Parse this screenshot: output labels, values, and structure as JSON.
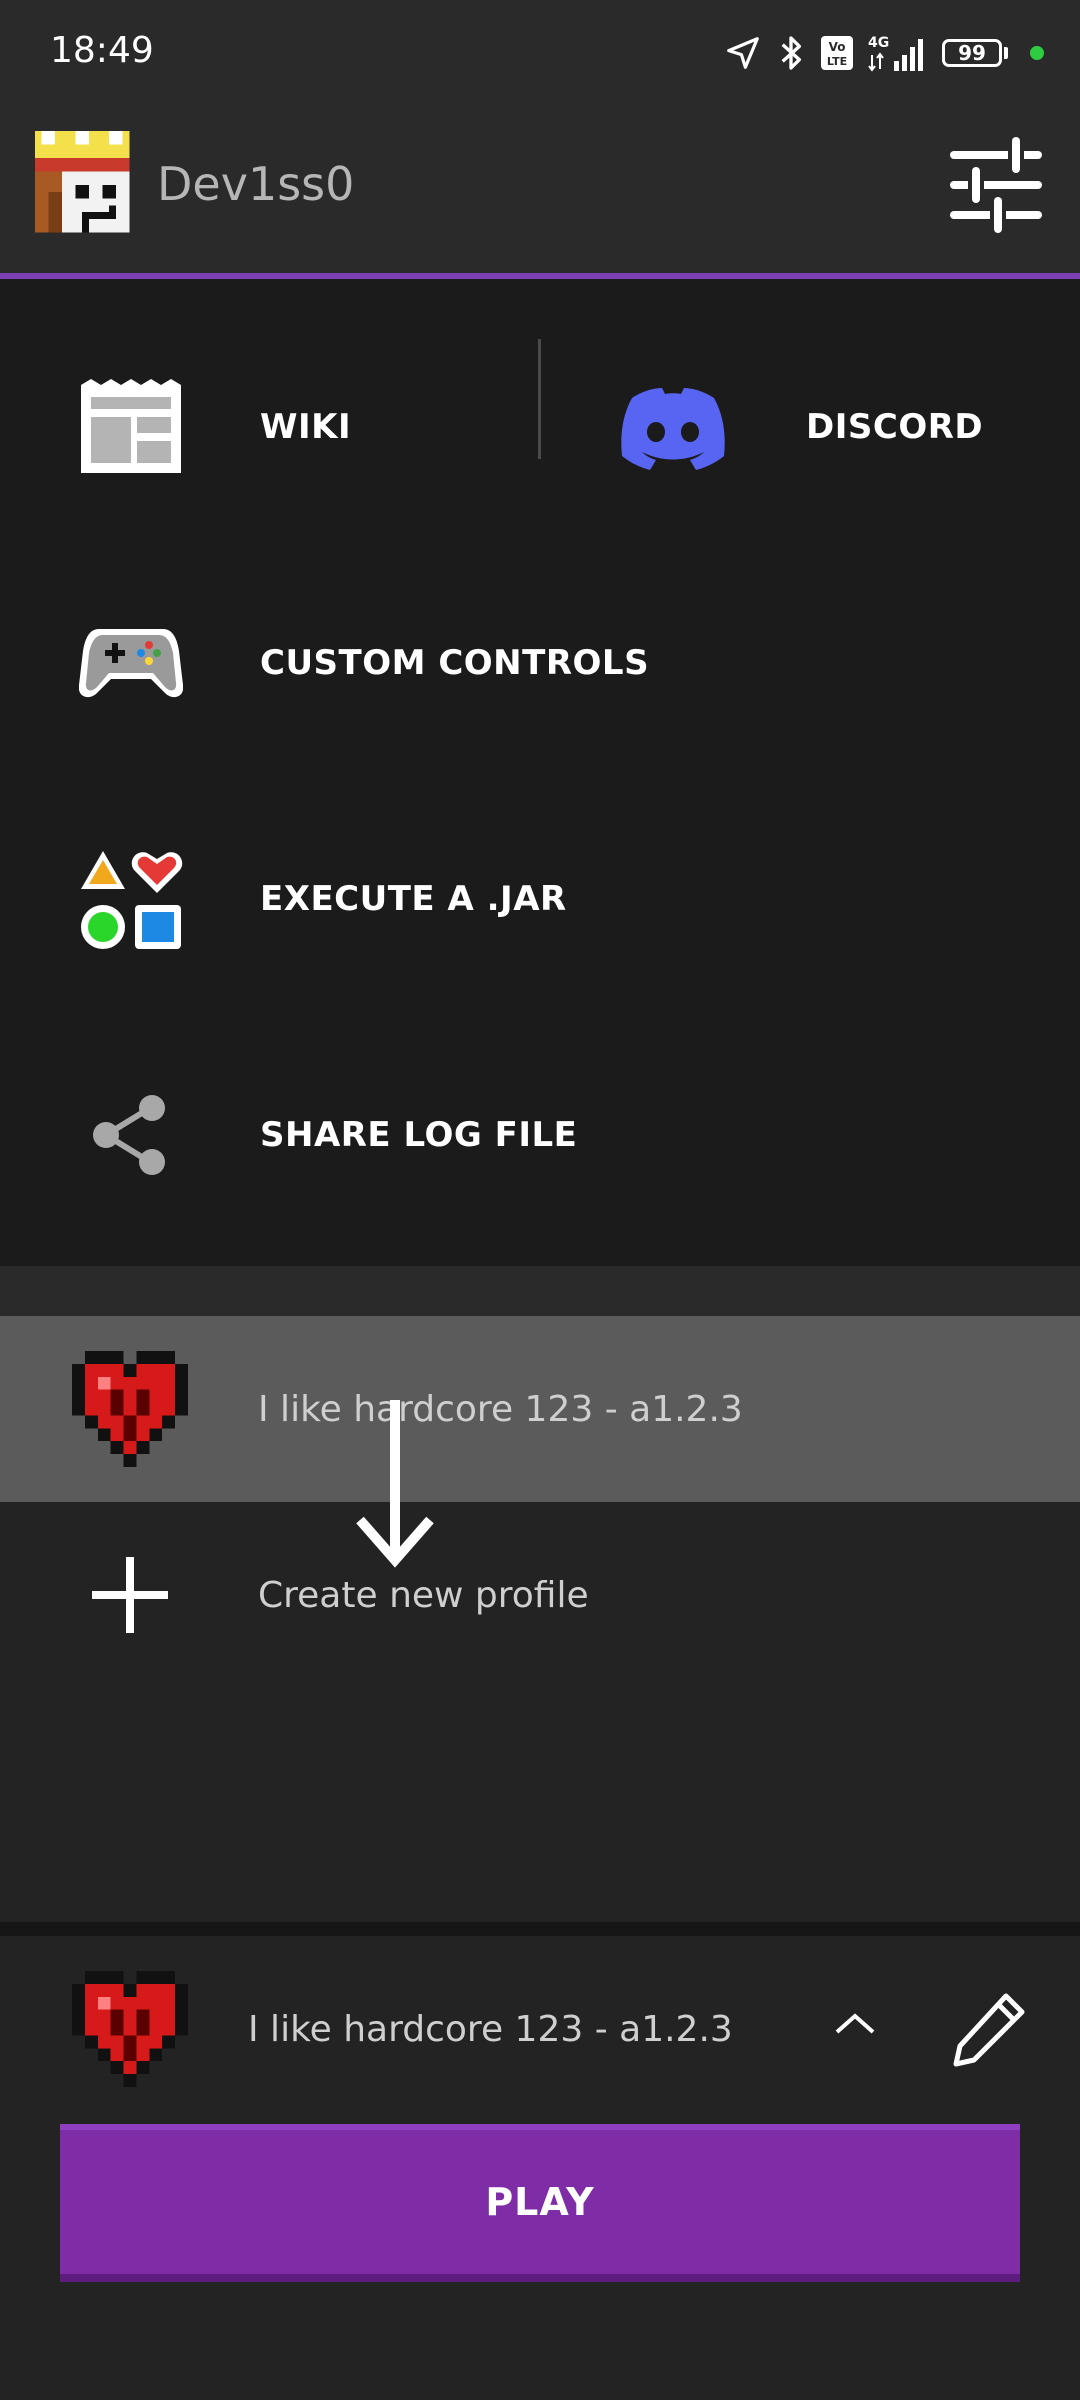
{
  "status_bar": {
    "time": "18:49",
    "battery": "99",
    "network": "4G",
    "volte": "Vo LTE"
  },
  "header": {
    "username": "Dev1ss0"
  },
  "menu": {
    "wiki_label": "WIKI",
    "discord_label": "DISCORD",
    "custom_controls_label": "CUSTOM CONTROLS",
    "execute_jar_label": "EXECUTE A .JAR",
    "share_log_label": "SHARE LOG FILE"
  },
  "profiles": {
    "items": [
      {
        "name": "I like hardcore 123 - a1.2.3",
        "selected": true
      }
    ],
    "create_label": "Create new profile"
  },
  "bottom": {
    "selected_profile": "I like hardcore 123 - a1.2.3",
    "play_label": "PLAY"
  },
  "colors": {
    "accent": "#7d3fb4",
    "play": "#7f2da6",
    "discord": "#5865f2"
  }
}
